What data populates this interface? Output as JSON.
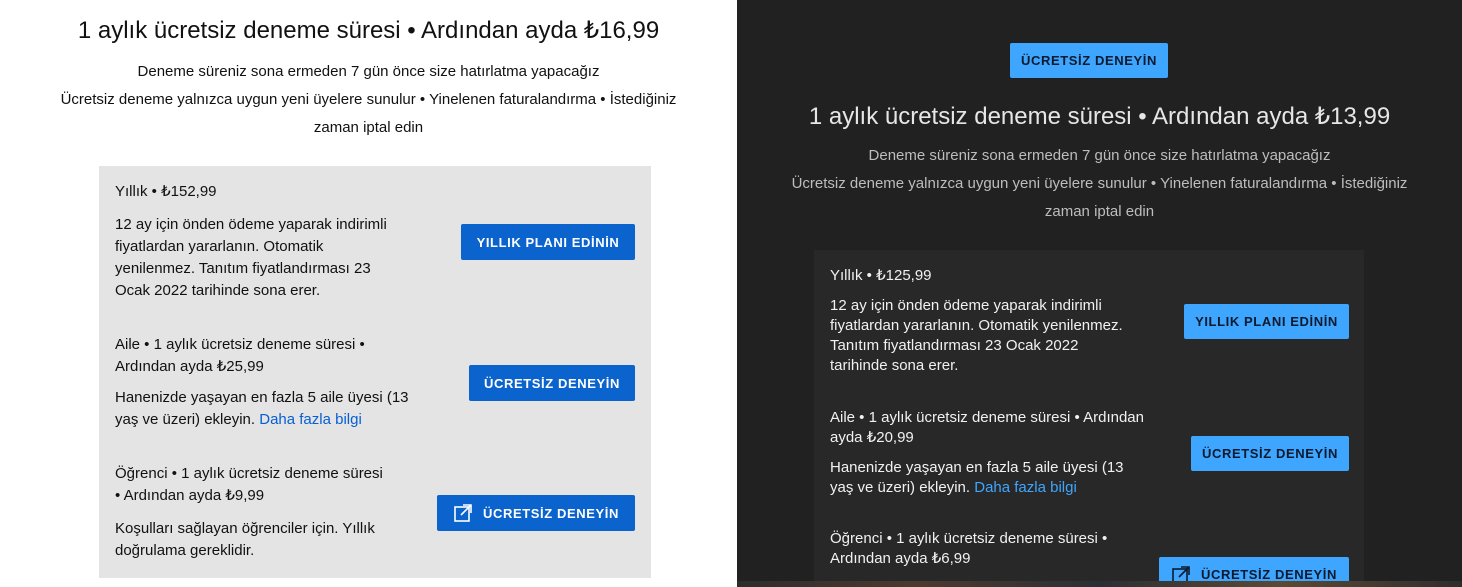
{
  "light": {
    "headline": "1 aylık ücretsiz deneme süresi • Ardından ayda ₺16,99",
    "reminder": "Deneme süreniz sona ermeden 7 gün önce size hatırlatma yapacağız",
    "terms_line1": "Ücretsiz deneme yalnızca uygun yeni üyelere sunulur • Yinelenen faturalandırma • İstediğiniz",
    "terms_line2": "zaman iptal edin",
    "yearly": {
      "title": "Yıllık • ₺152,99",
      "desc_l1": "12 ay için önden ödeme yaparak indirimli",
      "desc_l2": "fiyatlardan yararlanın. Otomatik",
      "desc_l3": "yenilenmez. Tanıtım fiyatlandırması 23",
      "desc_l4": "Ocak 2022 tarihinde sona erer.",
      "button": "YILLIK PLANI EDİNİN"
    },
    "family": {
      "title_l1": "Aile • 1 aylık ücretsiz deneme süresi •",
      "title_l2": "Ardından ayda ₺25,99",
      "desc_l1": "Hanenizde yaşayan en fazla 5 aile üyesi (13",
      "desc_l2": "yaş ve üzeri) ekleyin.",
      "link": "Daha fazla bilgi",
      "button": "ÜCRETSİZ DENEYİN"
    },
    "student": {
      "title_l1": "Öğrenci • 1 aylık ücretsiz deneme süresi",
      "title_l2": "• Ardından ayda ₺9,99",
      "desc_l1": "Koşulları sağlayan öğrenciler için. Yıllık",
      "desc_l2": "doğrulama gereklidir.",
      "button": "ÜCRETSİZ DENEYİN",
      "button_icon": "external-link-icon"
    }
  },
  "dark": {
    "top_button": "ÜCRETSİZ DENEYİN",
    "headline": "1 aylık ücretsiz deneme süresi • Ardından ayda ₺13,99",
    "reminder": "Deneme süreniz sona ermeden 7 gün önce size hatırlatma yapacağız",
    "terms_line1": "Ücretsiz deneme yalnızca uygun yeni üyelere sunulur • Yinelenen faturalandırma • İstediğiniz",
    "terms_line2": "zaman iptal edin",
    "yearly": {
      "title": "Yıllık • ₺125,99",
      "desc_l1": "12 ay için önden ödeme yaparak indirimli",
      "desc_l2": "fiyatlardan yararlanın. Otomatik yenilenmez.",
      "desc_l3": "Tanıtım fiyatlandırması 23 Ocak 2022",
      "desc_l4": "tarihinde sona erer.",
      "button": "YILLIK PLANI EDİNİN"
    },
    "family": {
      "title_l1": "Aile • 1 aylık ücretsiz deneme süresi • Ardından",
      "title_l2": "ayda ₺20,99",
      "desc_l1": "Hanenizde yaşayan en fazla 5 aile üyesi (13",
      "desc_l2": "yaş ve üzeri) ekleyin.",
      "link": "Daha fazla bilgi",
      "button": "ÜCRETSİZ DENEYİN"
    },
    "student": {
      "title_l1": "Öğrenci • 1 aylık ücretsiz deneme süresi •",
      "title_l2": "Ardından ayda ₺6,99",
      "button": "ÜCRETSİZ DENEYİN",
      "button_icon": "external-link-icon"
    }
  },
  "colors": {
    "light_card": "#e4e4e4",
    "dark_bg": "#212121",
    "dark_card": "#282828",
    "blue_button": "#0b63ce",
    "light_blue_button": "#3ea6ff"
  }
}
